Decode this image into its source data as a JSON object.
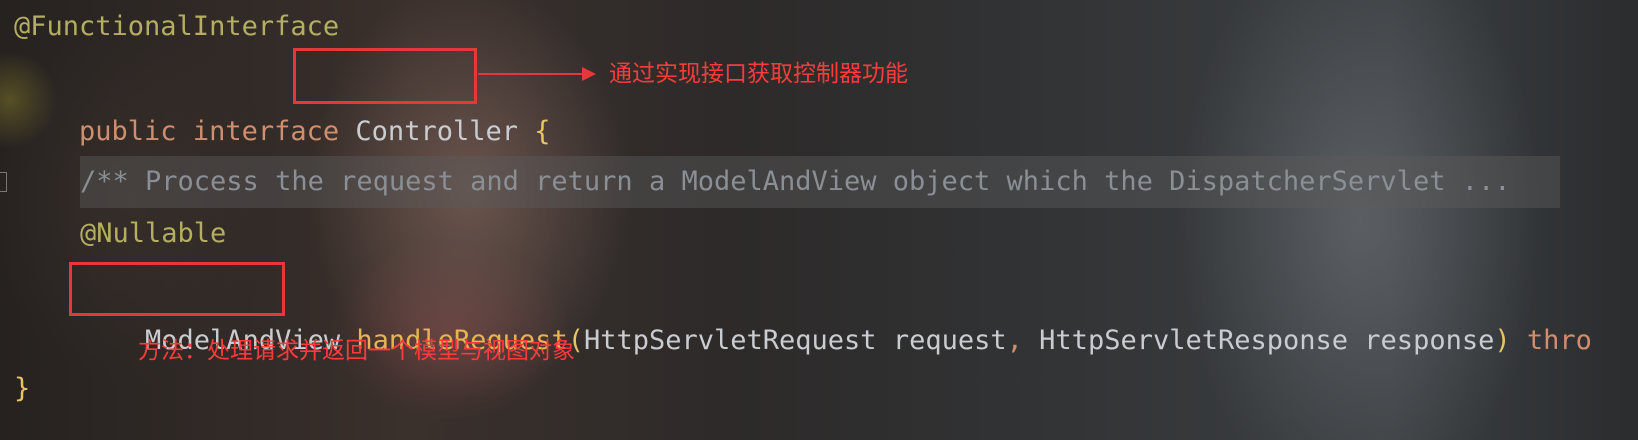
{
  "code": {
    "annotation_line": "@FunctionalInterface",
    "decl_kw_public": "public",
    "decl_kw_interface": "interface",
    "decl_name": "Controller",
    "decl_brace": "{",
    "doc_comment": "/** Process the request and return a ModelAndView object which the DispatcherServlet ...",
    "nullable": "@Nullable",
    "return_type": "ModelAndView",
    "method_name": "handleRequest",
    "paren_open": "(",
    "param1_type": "HttpServletRequest",
    "param1_name": "request",
    "comma": ",",
    "param2_type": "HttpServletResponse",
    "param2_name": "response",
    "paren_close": ")",
    "throws_kw": "thro",
    "closing_brace": "}"
  },
  "annotations": {
    "controller_note": "通过实现接口获取控制器功能",
    "method_note": "方法：处理请求并返回一个模型与视图对象"
  },
  "colors": {
    "highlight_red": "#e5383b",
    "keyword": "#cf8e6d",
    "annotation": "#b3ae60"
  }
}
